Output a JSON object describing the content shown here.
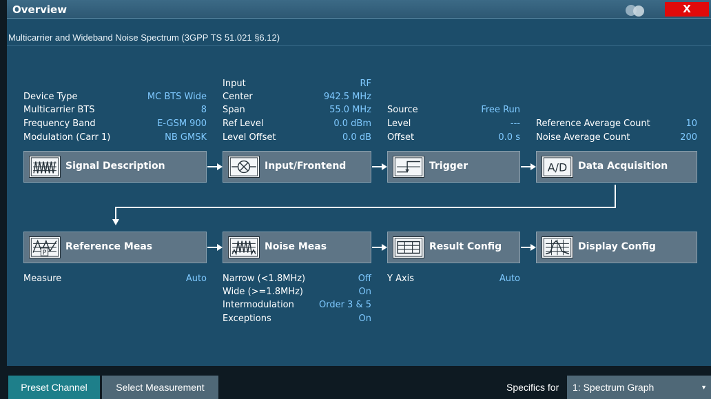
{
  "window": {
    "title": "Overview",
    "close_label": "X"
  },
  "subtitle": "Multicarrier and Wideband Noise Spectrum (3GPP TS 51.021 §6.12)",
  "signal_description": {
    "label": "Signal Description",
    "params": [
      {
        "k": "Device Type",
        "v": "MC BTS Wide"
      },
      {
        "k": "Multicarrier BTS",
        "v": "8"
      },
      {
        "k": "Frequency Band",
        "v": "E-GSM 900"
      },
      {
        "k": "Modulation (Carr 1)",
        "v": "NB GMSK"
      }
    ]
  },
  "input_frontend": {
    "label": "Input/Frontend",
    "params": [
      {
        "k": "Input",
        "v": "RF"
      },
      {
        "k": "Center",
        "v": "942.5 MHz"
      },
      {
        "k": "Span",
        "v": "55.0 MHz"
      },
      {
        "k": "Ref Level",
        "v": "0.0 dBm"
      },
      {
        "k": "Level Offset",
        "v": "0.0 dB"
      }
    ]
  },
  "trigger": {
    "label": "Trigger",
    "params": [
      {
        "k": "Source",
        "v": "Free Run"
      },
      {
        "k": "Level",
        "v": "---"
      },
      {
        "k": "Offset",
        "v": "0.0 s"
      }
    ]
  },
  "data_acquisition": {
    "label": "Data Acquisition",
    "params": [
      {
        "k": "Reference Average Count",
        "v": "10"
      },
      {
        "k": "Noise Average Count",
        "v": "200"
      }
    ]
  },
  "reference_meas": {
    "label": "Reference Meas",
    "params": [
      {
        "k": "Measure",
        "v": "Auto"
      }
    ]
  },
  "noise_meas": {
    "label": "Noise Meas",
    "params": [
      {
        "k": "Narrow (<1.8MHz)",
        "v": "Off"
      },
      {
        "k": "Wide (>=1.8MHz)",
        "v": "On"
      },
      {
        "k": "Intermodulation",
        "v": "Order 3 & 5"
      },
      {
        "k": "Exceptions",
        "v": "On"
      }
    ]
  },
  "result_config": {
    "label": "Result Config",
    "params": [
      {
        "k": "Y Axis",
        "v": "Auto"
      }
    ]
  },
  "display_config": {
    "label": "Display Config"
  },
  "bottom": {
    "preset_label": "Preset Channel",
    "select_label": "Select Measurement",
    "specifics_label": "Specifics for",
    "specifics_value": "1: Spectrum Graph"
  },
  "icons": {
    "signal": "signal-description-icon",
    "input": "input-frontend-icon",
    "trigger": "trigger-icon",
    "ad": "data-acquisition-icon",
    "reference": "reference-meas-icon",
    "noise": "noise-meas-icon",
    "result": "result-config-icon",
    "display": "display-config-icon"
  }
}
